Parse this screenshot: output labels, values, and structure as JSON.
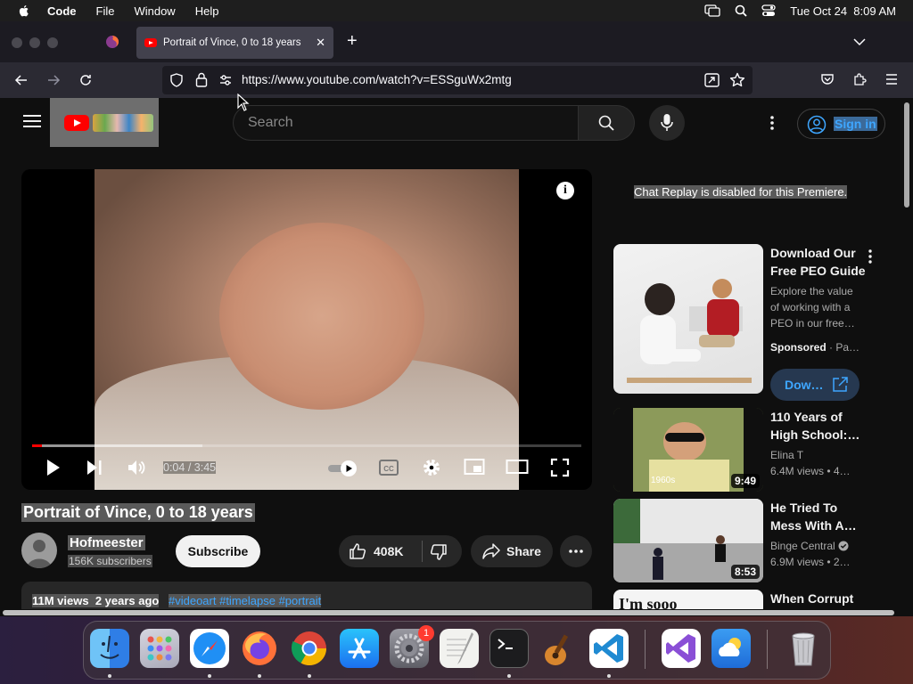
{
  "menubar": {
    "app_name": "Code",
    "menus": [
      "File",
      "Window",
      "Help"
    ],
    "clock": "Tue Oct 24  8:09 AM"
  },
  "browser": {
    "tab_title": "Portrait of Vince, 0 to 18 years",
    "tab_close": "✕",
    "new_tab": "+",
    "url": "https://www.youtube.com/watch?v=ESSguWx2mtg"
  },
  "youtube": {
    "search_placeholder": "Search",
    "sign_in": "Sign in",
    "player": {
      "info": "i",
      "time_current": "0:04",
      "time_total": "3:45",
      "progress_fraction": 0.018,
      "buffered_fraction": 0.31
    },
    "video": {
      "title": "Portrait of Vince, 0 to 18 years",
      "channel": "Hofmeester",
      "subscribers": "156K subscribers",
      "subscribe": "Subscribe",
      "likes": "408K",
      "share": "Share",
      "views_line": "11M views  2 years ago",
      "tags": "#videoart #timelapse #portrait"
    },
    "sidebar": {
      "chat_replay": "Chat Replay is disabled for this Premiere.",
      "items": [
        {
          "title": "Download Our Free PEO Guide",
          "description": "Explore the value of working with a PEO in our free…",
          "sponsored": "Sponsored",
          "advertiser": "· Pa…",
          "cta": "Dow…"
        },
        {
          "title": "110 Years of High School:…",
          "channel": "Elina T",
          "stats": "6.4M views  • 4…",
          "duration": "9:49",
          "thumb_caption": "1960s"
        },
        {
          "title": "He Tried To Mess With A…",
          "channel": "Binge Central",
          "stats": "6.9M views  • 2…",
          "duration": "8:53"
        },
        {
          "title": "When Corrupt",
          "thumb_caption": "I'm sooo"
        }
      ]
    }
  },
  "dock": {
    "settings_badge": "1"
  }
}
